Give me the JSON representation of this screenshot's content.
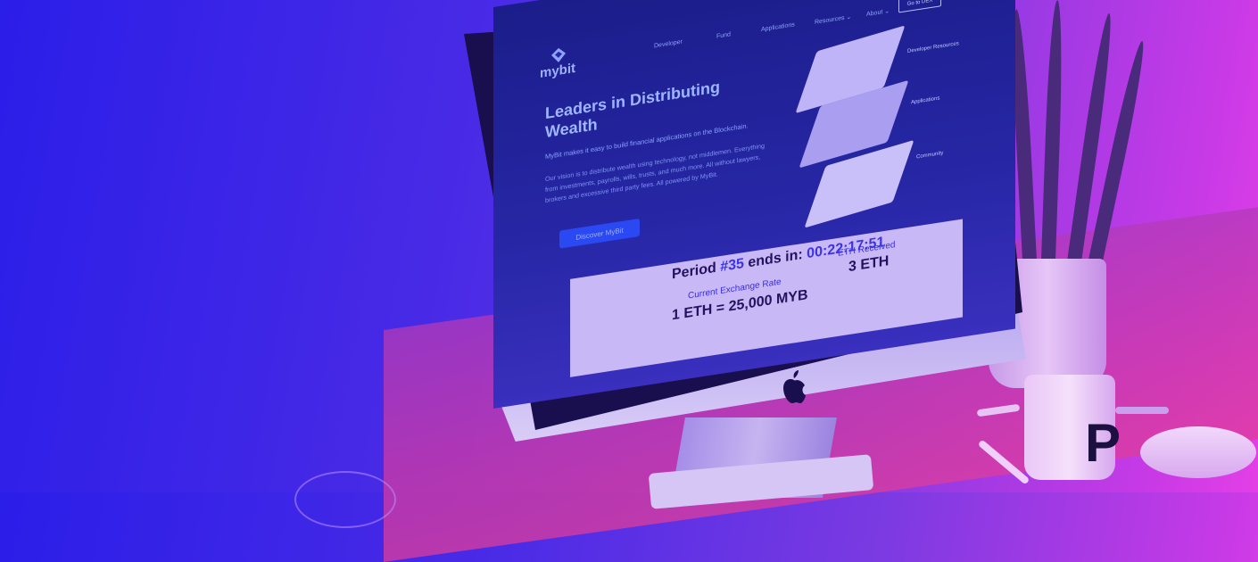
{
  "screen": {
    "logo_text": "mybit",
    "nav": [
      "Developer",
      "Fund",
      "Applications",
      "Resources ⌄",
      "About ⌄"
    ],
    "nav_button": "Go to DEX",
    "hero_title": "Leaders in Distributing Wealth",
    "hero_subtitle": "MyBit makes it easy to build financial applications on the Blockchain.",
    "hero_body": "Our vision is to distribute wealth using technology, not middlemen. Everything from investments, payrolls, wills, trusts, and much more. All without lawyers, brokers and excessive third party fees. All powered by MyBit.",
    "cta_label": "Discover MyBit",
    "diagram_labels": [
      "Developer Resources",
      "Applications",
      "Community"
    ],
    "period_prefix": "Period ",
    "period_number": "#35",
    "period_suffix": " ends in: ",
    "period_countdown": "00:22:17:51",
    "exchange_label": "Current Exchange Rate",
    "exchange_value": "1 ETH = 25,000 MYB",
    "eth_label": "ETH Received",
    "eth_value": "3 ETH"
  },
  "mug_letter": "P",
  "colors": {
    "gradient_left": "#2b1ee8",
    "gradient_right": "#e43fe6",
    "cta": "#2a49f2"
  }
}
